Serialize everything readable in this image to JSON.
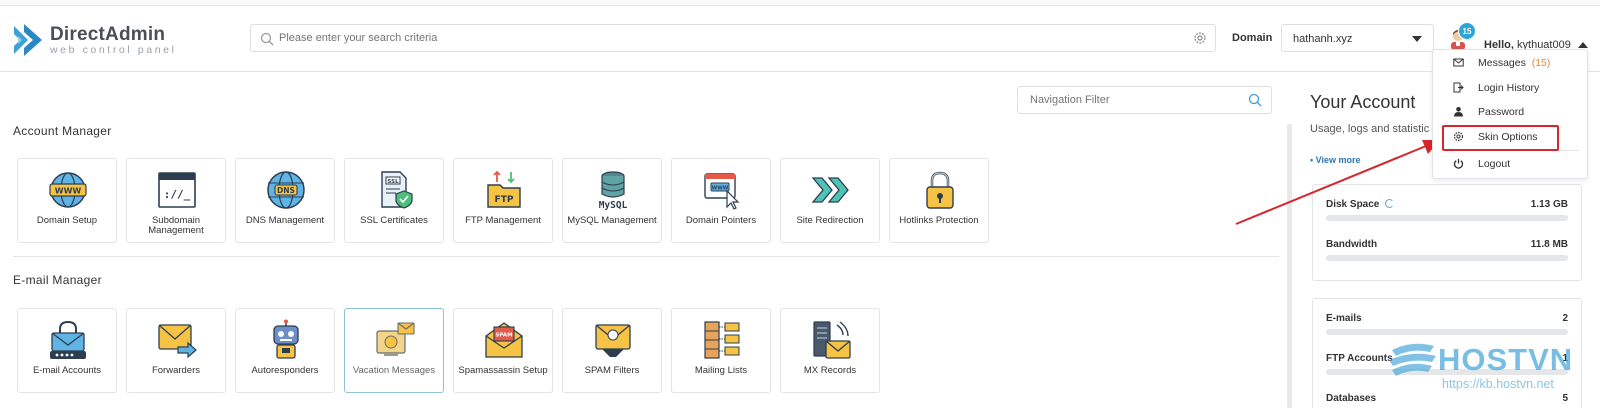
{
  "app": {
    "logo_title": "DirectAdmin",
    "logo_subtitle": "web control panel"
  },
  "header": {
    "search_placeholder": "Please enter your search criteria",
    "domain_label": "Domain",
    "domain_value": "hathanh.xyz",
    "notification_count": "15",
    "hello_prefix": "Hello,",
    "username": "kythuat009"
  },
  "user_menu": {
    "items": [
      {
        "label": "Messages",
        "count": "(15)",
        "icon": "envelope-icon"
      },
      {
        "label": "Login History",
        "icon": "login-history-icon"
      },
      {
        "label": "Password",
        "icon": "user-icon"
      },
      {
        "label": "Skin Options",
        "icon": "gear-icon"
      },
      {
        "label": "Logout",
        "icon": "power-icon"
      }
    ]
  },
  "main": {
    "nav_filter_placeholder": "Navigation Filter",
    "sections": [
      {
        "title": "Account Manager",
        "tiles": [
          {
            "label": "Domain Setup",
            "icon": "www-globe-icon"
          },
          {
            "label": "Subdomain Management",
            "icon": "subdomain-browser-icon"
          },
          {
            "label": "DNS Management",
            "icon": "dns-globe-icon"
          },
          {
            "label": "SSL Certificates",
            "icon": "ssl-certificate-icon"
          },
          {
            "label": "FTP Management",
            "icon": "ftp-folder-icon"
          },
          {
            "label": "MySQL Management",
            "icon": "mysql-database-icon"
          },
          {
            "label": "Domain Pointers",
            "icon": "domain-pointer-icon"
          },
          {
            "label": "Site Redirection",
            "icon": "redirect-arrows-icon"
          },
          {
            "label": "Hotlinks Protection",
            "icon": "padlock-icon"
          }
        ]
      },
      {
        "title": "E-mail Manager",
        "tiles": [
          {
            "label": "E-mail Accounts",
            "icon": "email-account-icon"
          },
          {
            "label": "Forwarders",
            "icon": "forward-envelope-icon"
          },
          {
            "label": "Autoresponders",
            "icon": "robot-icon"
          },
          {
            "label": "Vacation Messages",
            "icon": "vacation-envelope-icon"
          },
          {
            "label": "Spamassassin Setup",
            "icon": "spam-envelope-icon"
          },
          {
            "label": "SPAM Filters",
            "icon": "spam-filter-icon"
          },
          {
            "label": "Mailing Lists",
            "icon": "mailing-list-icon"
          },
          {
            "label": "MX Records",
            "icon": "mx-server-icon"
          }
        ]
      }
    ]
  },
  "your_account": {
    "title": "Your Account",
    "subtitle": "Usage, logs and statistic",
    "view_more": "• View more",
    "usage": [
      {
        "name": "Disk Space",
        "value": "1.13 GB"
      },
      {
        "name": "Bandwidth",
        "value": "11.8 MB"
      }
    ],
    "counts": [
      {
        "name": "E-mails",
        "value": "2"
      },
      {
        "name": "FTP Accounts",
        "value": "1"
      },
      {
        "name": "Databases",
        "value": "5"
      }
    ]
  },
  "watermark": {
    "brand": "HOSTVN",
    "url": "https://kb.hostvn.net"
  },
  "colors": {
    "accent": "#2aa6d9",
    "highlight": "#d6262c",
    "count_orange": "#e8843a",
    "link_blue": "#2a76b8"
  }
}
